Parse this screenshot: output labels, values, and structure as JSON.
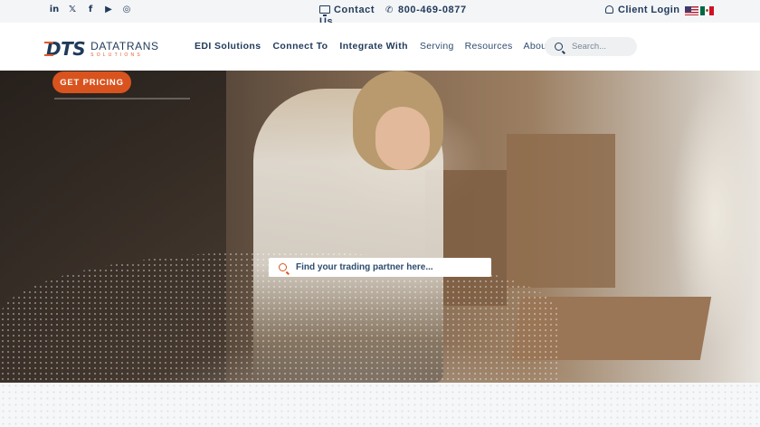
{
  "topbar": {
    "social": [
      {
        "icon": "linkedin-icon",
        "glyph": "in"
      },
      {
        "icon": "x-twitter-icon",
        "glyph": "𝕏"
      },
      {
        "icon": "facebook-icon",
        "glyph": "f"
      },
      {
        "icon": "youtube-icon",
        "glyph": "▶"
      },
      {
        "icon": "instagram-icon",
        "glyph": "◎"
      }
    ],
    "contact_label": "Contact Us",
    "phone": "800-469-0877",
    "login_label": "Client Login",
    "languages": [
      "flag-us-icon",
      "flag-mx-icon"
    ]
  },
  "header": {
    "logo_mark": "DTS",
    "logo_name": "DATATRANS",
    "logo_sub": "SOLUTIONS",
    "nav": [
      "EDI Solutions",
      "Connect To",
      "Integrate With",
      "Serving",
      "Resources",
      "About Us"
    ],
    "search_placeholder": "Search..."
  },
  "hero": {
    "cta_label": "GET PRICING",
    "partner_search_placeholder": "Find your trading partner here..."
  },
  "colors": {
    "brand_navy": "#1f3a5a",
    "brand_orange": "#d9531e"
  }
}
